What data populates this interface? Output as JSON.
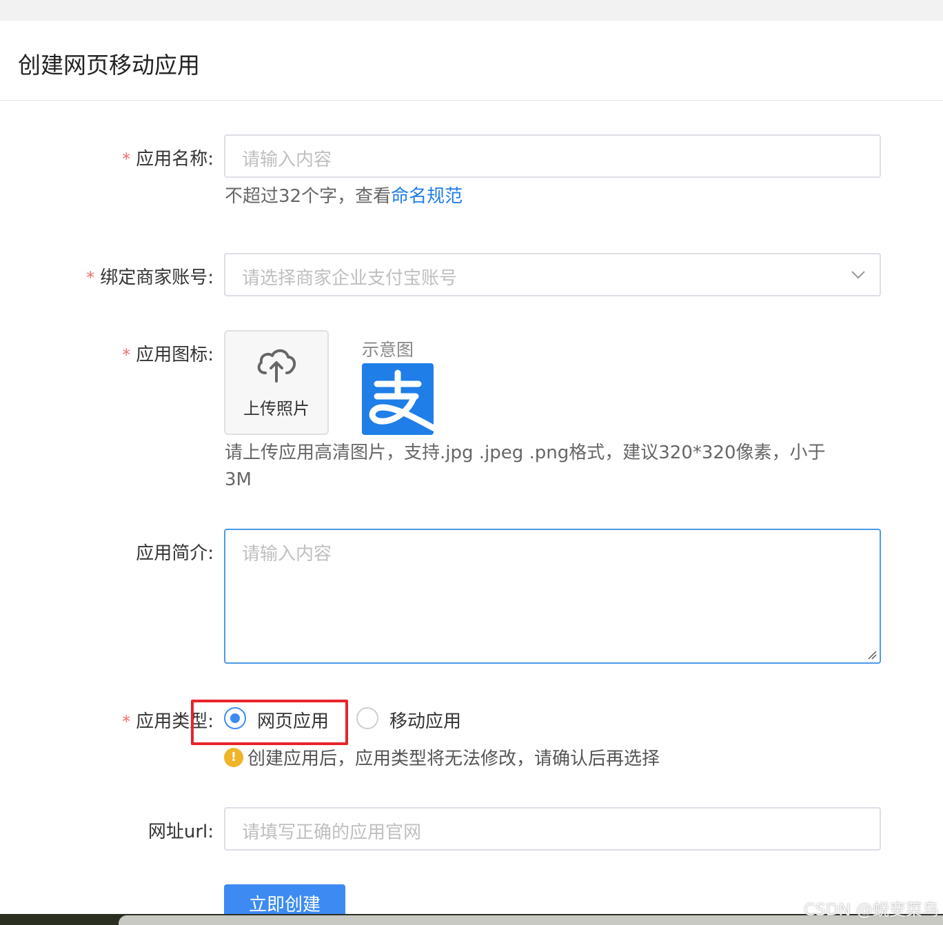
{
  "page": {
    "title": "创建网页移动应用"
  },
  "form": {
    "app_name": {
      "label": "应用名称:",
      "placeholder": "请输入内容",
      "hint_prefix": "不超过32个字，查看",
      "hint_link": "命名规范"
    },
    "merchant_account": {
      "label": "绑定商家账号:",
      "placeholder": "请选择商家企业支付宝账号",
      "icon": "chevron-down-icon"
    },
    "app_icon": {
      "label": "应用图标:",
      "upload_label": "上传照片",
      "upload_icon": "cloud-upload-icon",
      "example_label": "示意图",
      "example_logo": "alipay-logo",
      "hint_line1": "请上传应用高清图片，支持.jpg .jpeg .png格式，建议320*320像素，小于",
      "hint_line2": "3M"
    },
    "app_intro": {
      "label": "应用简介:",
      "placeholder": "请输入内容"
    },
    "app_type": {
      "label": "应用类型:",
      "options": [
        {
          "label": "网页应用",
          "selected": true
        },
        {
          "label": "移动应用",
          "selected": false
        }
      ],
      "warning_icon": "warning-icon",
      "warning_text": "创建应用后，应用类型将无法修改，请确认后再选择"
    },
    "website_url": {
      "label": "网址url:",
      "placeholder": "请填写正确的应用官网"
    },
    "submit_label": "立即创建"
  },
  "colors": {
    "primary": "#3d8bf2",
    "link": "#1f7ee8",
    "required_star": "#f56c6c",
    "highlight_border": "#e8232a",
    "warning": "#f0b429"
  },
  "watermark": "CSDN @蜕变菜鸟"
}
